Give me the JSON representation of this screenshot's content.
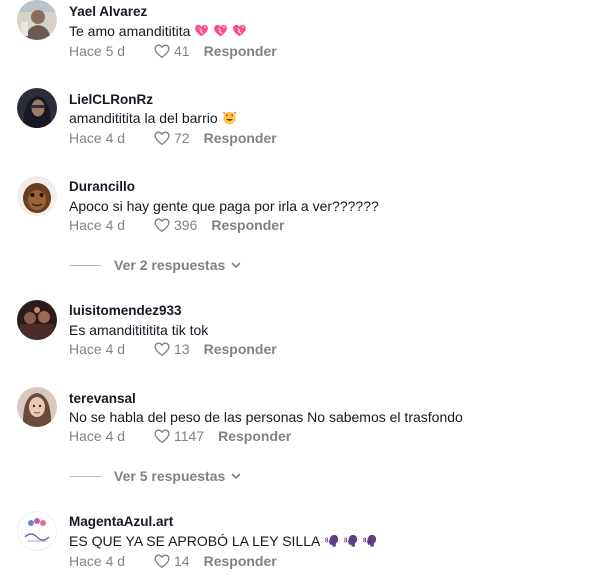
{
  "colors": {
    "text": "#161823",
    "muted": "rgba(22,24,35,0.55)",
    "heart_pink": "#ff4f87"
  },
  "comments": [
    {
      "username": "Yael Alvarez",
      "text": "Te amo amandititita",
      "emoji": [
        "heart-icon",
        "heart-icon",
        "heart-icon"
      ],
      "date": "Hace 5 d",
      "likes": "41",
      "reply_label": "Responder"
    },
    {
      "username": "LielCLRonRz",
      "text": "amandititita la del barrio",
      "emoji": [
        "smiling-hearts-face-icon"
      ],
      "date": "Hace 4 d",
      "likes": "72",
      "reply_label": "Responder"
    },
    {
      "username": "Durancillo",
      "text": "Apoco si hay gente que paga por irla a ver??????",
      "date": "Hace 4 d",
      "likes": "396",
      "reply_label": "Responder",
      "view_replies": "Ver 2 respuestas"
    },
    {
      "username": "luisitomendez933",
      "text": "Es amanditititita tik tok",
      "date": "Hace 4 d",
      "likes": "13",
      "reply_label": "Responder"
    },
    {
      "username": "terevansal",
      "text": "No se habla del peso de las personas No sabemos el trasfondo",
      "date": "Hace 4 d",
      "likes": "1147",
      "reply_label": "Responder",
      "view_replies": "Ver 5 respuestas"
    },
    {
      "username": "MagentaAzul.art",
      "text": "ES QUE YA SE APROBÓ LA LEY SILLA",
      "emoji": [
        "speaking-head-icon",
        "speaking-head-icon",
        "speaking-head-icon"
      ],
      "date": "Hace 4 d",
      "likes": "14",
      "reply_label": "Responder"
    }
  ]
}
